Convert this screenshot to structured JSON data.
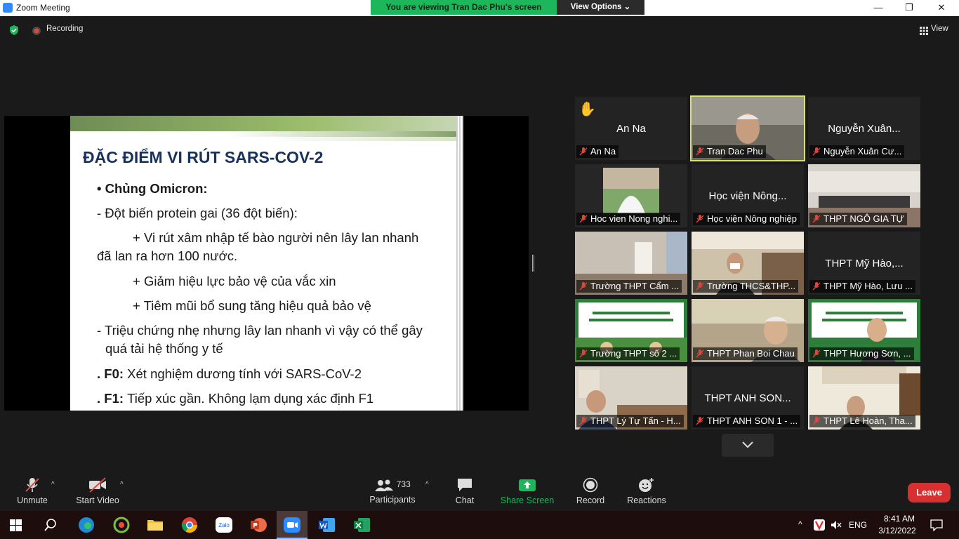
{
  "window": {
    "title": "Zoom Meeting",
    "minimize": "—",
    "maximize": "❐",
    "close": "✕"
  },
  "banner": {
    "message": "You are viewing Tran Dac Phu's screen",
    "view_options": "View Options ⌄"
  },
  "top": {
    "recording": "Recording",
    "view": "View"
  },
  "slide": {
    "title": "ĐẶC ĐIỂM VI RÚT SARS-COV-2",
    "lines": [
      "• Chủng Omicron:",
      "- Đột  biến protein gai (36 đột biến):",
      "+ Vi rút xâm nhập tế bào người nên lây lan nhanh",
      "đã lan ra hơn 100 nước.",
      "+ Giảm hiệu lực bảo vệ của vắc xin",
      "+ Tiêm mũi bổ sung tăng hiệu quả bảo vệ",
      "- Triệu chứng nhẹ nhưng lây lan nhanh vì vậy có thể gây",
      "quá tải hệ thống y tế",
      ". F0: ",
      "Xét nghiệm dương tính với SARS-CoV-2",
      ". F1: ",
      "Tiếp xúc gần. Không lạm dụng xác định F1"
    ]
  },
  "participants_grid": [
    {
      "label": "An Na",
      "center": "An Na",
      "hand": "✋"
    },
    {
      "label": "Tran Dac Phu",
      "center": ""
    },
    {
      "label": "Nguyễn Xuân Cư...",
      "center": "Nguyễn Xuân..."
    },
    {
      "label": "Hoc vien Nong nghi...",
      "center": ""
    },
    {
      "label": "Học viện Nông nghiệp",
      "center": "Học viện Nông..."
    },
    {
      "label": "THPT NGÔ GIA TỰ",
      "center": ""
    },
    {
      "label": "Trường THPT Cẩm ...",
      "center": ""
    },
    {
      "label": "Trường THCS&THP...",
      "center": ""
    },
    {
      "label": "THPT Mỹ Hào, Lưu ...",
      "center": "THPT Mỹ Hào,..."
    },
    {
      "label": "Trường THPT số 2 ...",
      "center": ""
    },
    {
      "label": "THPT Phan Boi Chau",
      "center": ""
    },
    {
      "label": "THPT Hương Sơn, ...",
      "center": ""
    },
    {
      "label": "THPT Lý Tự Tấn - H...",
      "center": ""
    },
    {
      "label": "THPT ANH SON 1 - ...",
      "center": "THPT ANH SON..."
    },
    {
      "label": "THPT Lê Hoàn, Tha...",
      "center": ""
    }
  ],
  "toolbar": {
    "unmute": "Unmute",
    "start_video": "Start Video",
    "participants_count": "733",
    "participants": "Participants",
    "chat": "Chat",
    "share_screen": "Share Screen",
    "record": "Record",
    "reactions": "Reactions",
    "leave": "Leave"
  },
  "taskbar": {
    "lang": "ENG",
    "time": "8:41 AM",
    "date": "3/12/2022",
    "zalo": "Zalo"
  },
  "colors": {
    "share_green": "#1db65a",
    "leave_red": "#d83030",
    "active_speaker": "#d8e26b"
  }
}
